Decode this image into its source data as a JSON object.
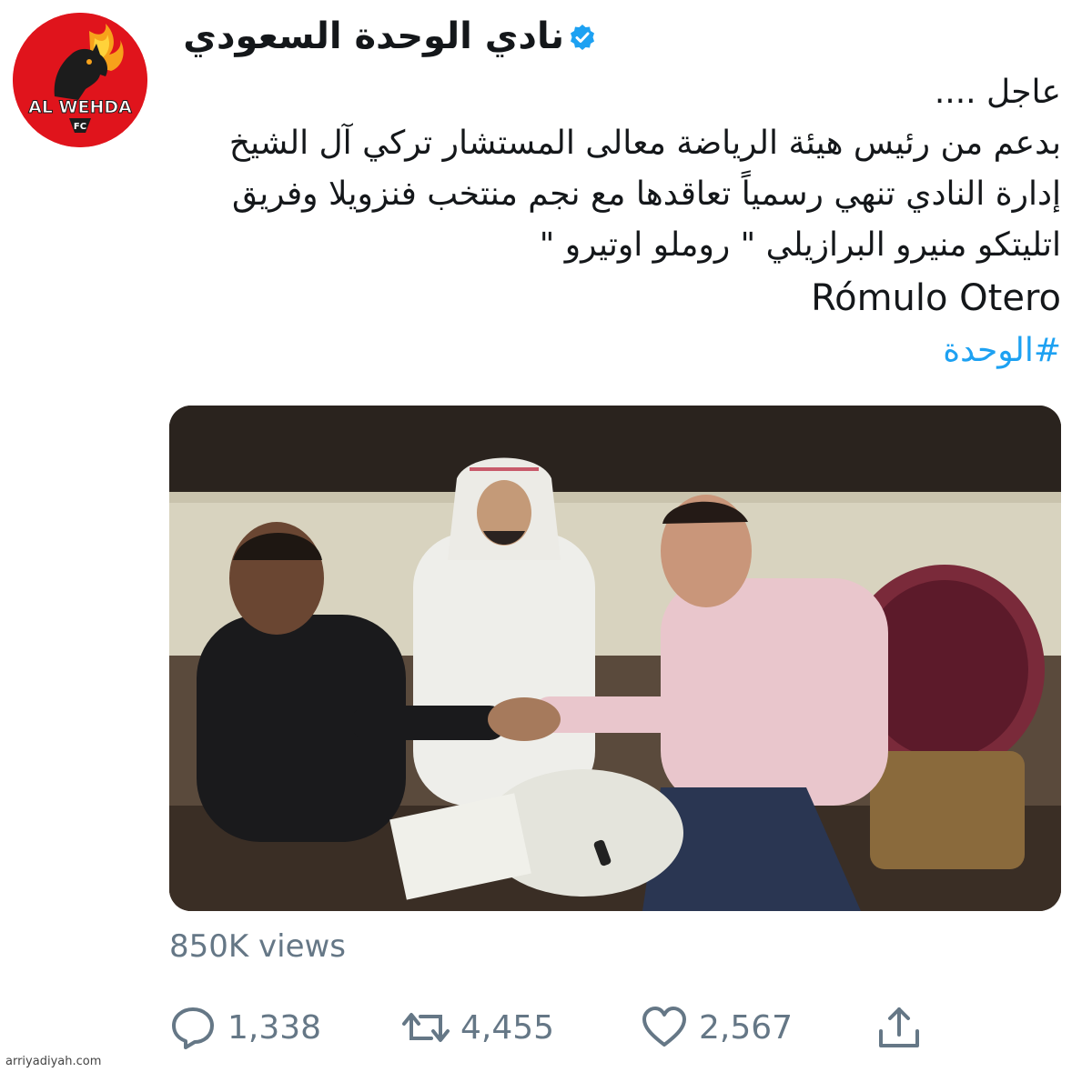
{
  "header": {
    "account_name": "نادي الوحدة السعودي",
    "avatar_text": "AL WEHDA",
    "avatar_sub": "FC"
  },
  "tweet": {
    "lines": [
      "عاجل ....",
      "بدعم من رئيس هيئة الرياضة معالى المستشار تركي آل الشيخ",
      "إدارة النادي تنهي رسمياً تعاقدها مع نجم منتخب فنزويلا وفريق",
      "اتليتكو منيرو البرازيلي \" روملو اوتيرو \""
    ],
    "latin_name": "Rómulo Otero",
    "hashtag": "#الوحدة"
  },
  "stats": {
    "views": "850K views",
    "replies": "1,338",
    "retweets": "4,455",
    "likes": "2,567"
  },
  "watermark": "arriyadiyah.com",
  "colors": {
    "link": "#1da1f2",
    "muted": "#657786",
    "avatar_bg": "#e0141c",
    "verified": "#1da1f2"
  }
}
